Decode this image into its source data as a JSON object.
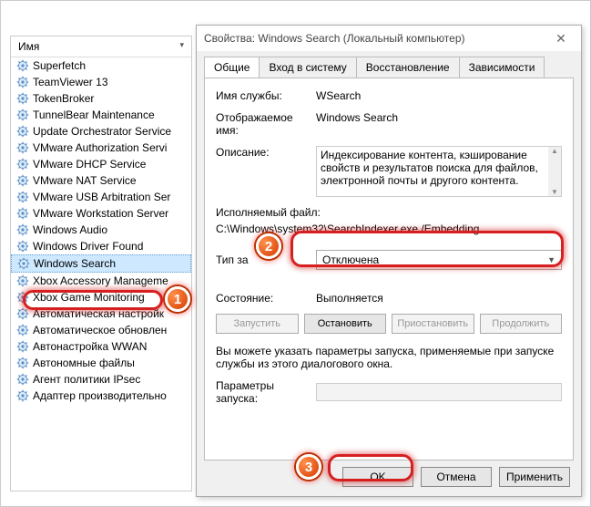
{
  "services": {
    "column_header": "Имя",
    "items": [
      "Superfetch",
      "TeamViewer 13",
      "TokenBroker",
      "TunnelBear Maintenance",
      "Update Orchestrator Service",
      "VMware Authorization Servi",
      "VMware DHCP Service",
      "VMware NAT Service",
      "VMware USB Arbitration Ser",
      "VMware Workstation Server",
      "Windows Audio",
      "Windows Driver Found",
      "Windows Search",
      "Xbox Accessory Manageme",
      "Xbox Game Monitoring",
      "Автоматическая настройк",
      "Автоматическое обновлен",
      "Автонастройка WWAN",
      "Автономные файлы",
      "Агент политики IPsec",
      "Адаптер производительно"
    ],
    "selected_index": 12
  },
  "dialog": {
    "title": "Свойства: Windows Search (Локальный компьютер)",
    "tabs": [
      "Общие",
      "Вход в систему",
      "Восстановление",
      "Зависимости"
    ],
    "active_tab": 0,
    "labels": {
      "service_name": "Имя службы:",
      "display_name": "Отображаемое имя:",
      "description": "Описание:",
      "exe_label": "Исполняемый файл:",
      "startup_type": "Тип за",
      "state": "Состояние:",
      "start_params_hint": "Вы можете указать параметры запуска, применяемые при запуске службы из этого диалогового окна.",
      "start_params": "Параметры запуска:"
    },
    "values": {
      "service_name": "WSearch",
      "display_name": "Windows Search",
      "description": "Индексирование контента, кэширование свойств и результатов поиска для файлов, электронной почты и другого контента.",
      "exe_path": "C:\\Windows\\system32\\SearchIndexer.exe /Embedding",
      "startup_selected": "Отключена",
      "state": "Выполняется",
      "start_params_value": ""
    },
    "buttons": {
      "start": "Запустить",
      "stop": "Остановить",
      "pause": "Приостановить",
      "resume": "Продолжить",
      "ok": "OK",
      "cancel": "Отмена",
      "apply": "Применить"
    }
  },
  "markers": {
    "m1": "1",
    "m2": "2",
    "m3": "3"
  }
}
